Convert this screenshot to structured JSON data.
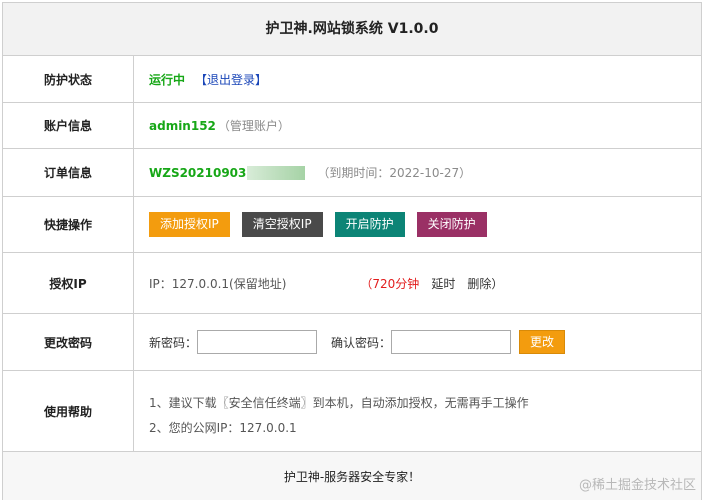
{
  "title": "护卫神.网站锁系统 V1.0.0",
  "rows": {
    "status": {
      "label": "防护状态",
      "value": "运行中",
      "logout": "【退出登录】"
    },
    "account": {
      "label": "账户信息",
      "user": "admin152",
      "role": "（管理账户）"
    },
    "order": {
      "label": "订单信息",
      "order_no": "WZS20210903",
      "expiry": "（到期时间：2022-10-27）"
    },
    "quick": {
      "label": "快捷操作",
      "buttons": [
        "添加授权IP",
        "清空授权IP",
        "开启防护",
        "关闭防护"
      ]
    },
    "auth_ip": {
      "label": "授权IP",
      "ip": "IP：127.0.0.1(保留地址)",
      "minutes": "（720分钟",
      "extend": "延时",
      "delete": "删除）"
    },
    "password": {
      "label": "更改密码",
      "new_label": "新密码：",
      "new_value": "",
      "confirm_label": "确认密码：",
      "confirm_value": "",
      "submit": "更改"
    },
    "help": {
      "label": "使用帮助",
      "line1": "1、建议下载〖安全信任终端〗到本机，自动添加授权，无需再手工操作",
      "line2": "2、您的公网IP：127.0.0.1"
    }
  },
  "footer": "护卫神-服务器安全专家！",
  "watermark": "@稀土掘金技术社区",
  "colors": {
    "orange": "#f39c0e",
    "dark": "#4a4a4a",
    "teal": "#0c8476",
    "purple": "#9a3065",
    "green": "#17a717",
    "blue": "#1a46b8",
    "red": "#e21d1d"
  }
}
